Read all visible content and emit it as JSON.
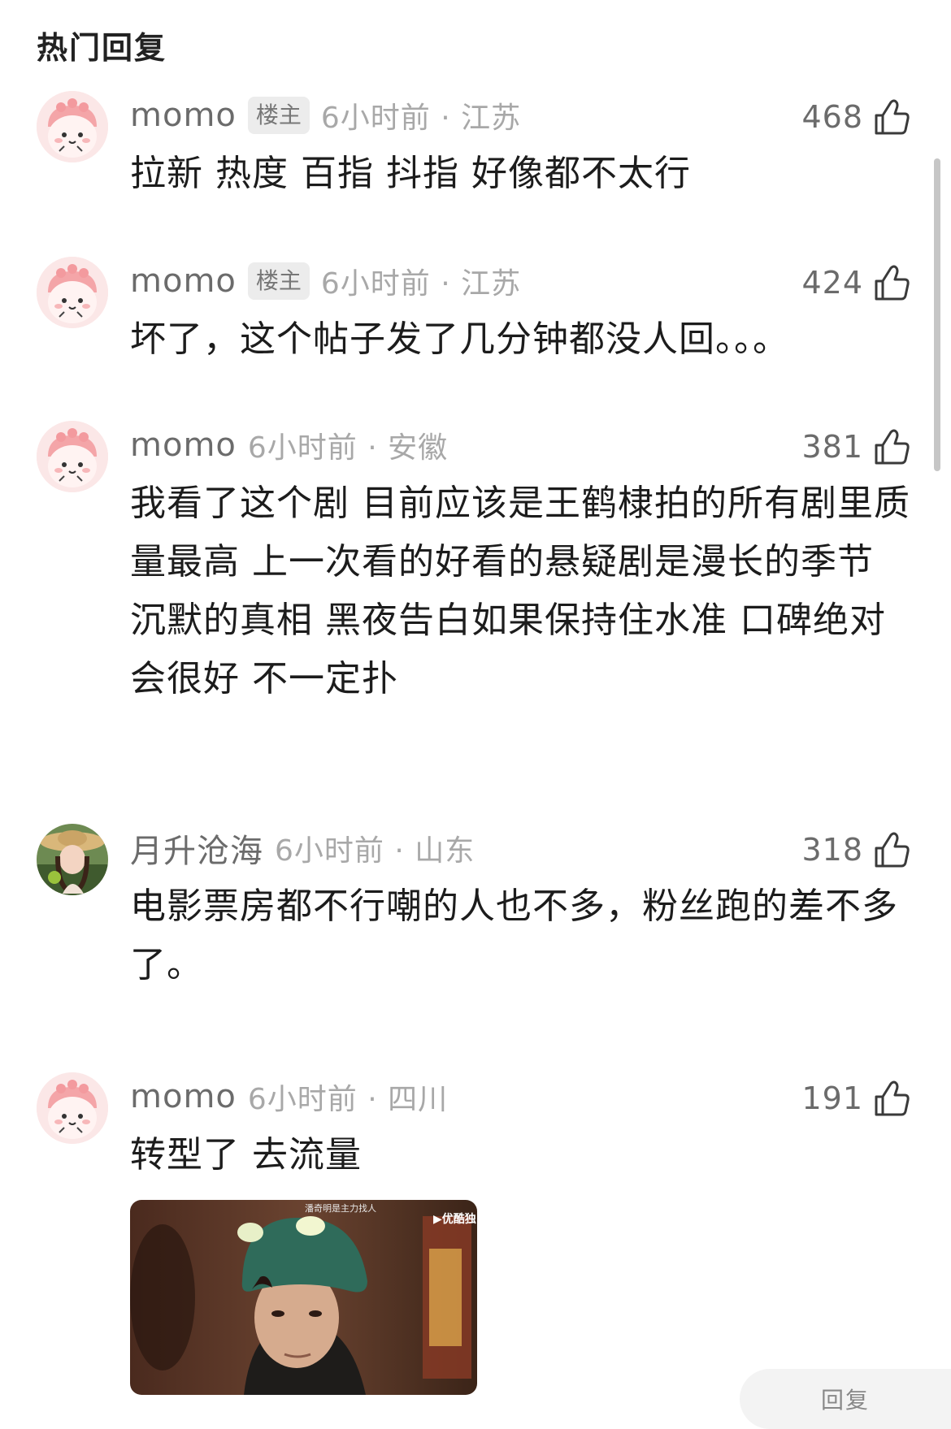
{
  "section_title": "热门回复",
  "comments": [
    {
      "author": "momo",
      "badge": "楼主",
      "time": "6小时前 · 江苏",
      "likes": "468",
      "text": "拉新 热度 百指 抖指 好像都不太行"
    },
    {
      "author": "momo",
      "badge": "楼主",
      "time": "6小时前 · 江苏",
      "likes": "424",
      "text": "坏了，这个帖子发了几分钟都没人回。。。"
    },
    {
      "author": "momo",
      "time": "6小时前 · 安徽",
      "likes": "381",
      "text": "我看了这个剧 目前应该是王鹤棣拍的所有剧里质量最高  上一次看的好看的悬疑剧是漫长的季节 沉默的真相 黑夜告白如果保持住水准 口碑绝对会很好  不一定扑"
    },
    {
      "author": "月升沧海",
      "time": "6小时前 · 山东",
      "likes": "318",
      "text": "电影票房都不行嘲的人也不多，粉丝跑的差不多了。"
    },
    {
      "author": "momo",
      "time": "6小时前 · 四川",
      "likes": "191",
      "text": "转型了 去流量"
    }
  ],
  "image": {
    "caption": "潘奇明是主力找人",
    "watermark": "▶优酷独"
  },
  "quick_reply": "回复"
}
